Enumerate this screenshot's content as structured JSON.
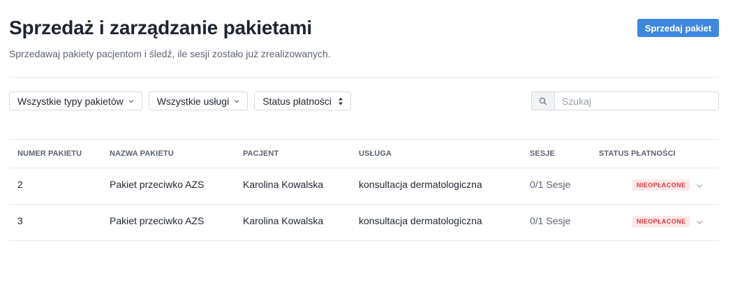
{
  "header": {
    "title": "Sprzedaż i zarządzanie pakietami",
    "subtitle": "Sprzedawaj pakiety pacjentom i śledź, ile sesji zostało już zrealizowanych.",
    "sell_button_label": "Sprzedaj pakiet"
  },
  "filters": {
    "package_type": "Wszystkie typy pakietów",
    "service": "Wszystkie usługi",
    "payment_status": "Status płatności"
  },
  "search": {
    "placeholder": "Szukaj",
    "value": ""
  },
  "table": {
    "columns": [
      "NUMER PAKIETU",
      "NAZWA PAKIETU",
      "PACJENT",
      "USŁUGA",
      "SESJE",
      "STATUS PŁATNOŚCI"
    ],
    "rows": [
      {
        "number": "2",
        "name": "Pakiet przeciwko AZS",
        "patient": "Karolina Kowalska",
        "service": "konsultacja dermatologiczna",
        "sessions": "0/1 Sesje",
        "status": "NIEOPŁACONE"
      },
      {
        "number": "3",
        "name": "Pakiet przeciwko AZS",
        "patient": "Karolina Kowalska",
        "service": "konsultacja dermatologiczna",
        "sessions": "0/1 Sesje",
        "status": "NIEOPŁACONE"
      }
    ]
  },
  "colors": {
    "accent": "#3d87de",
    "unpaid_text": "#d9363e",
    "unpaid_bg": "#fde8e8"
  },
  "icons": {
    "dropdown": "chevron-down-icon",
    "sort": "sort-updown-icon",
    "search": "search-icon",
    "row_expand": "chevron-down-icon"
  }
}
